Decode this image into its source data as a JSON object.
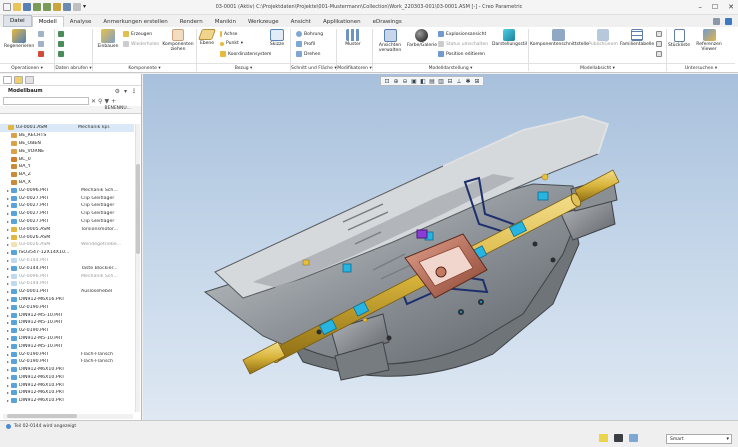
{
  "window": {
    "title": "03-0001 (Aktiv) C:\\Projektdaten\\Projekte\\001-Mustermann\\Collection\\Work_220303-001\\03-0001.ASM [-] - Creo Parametric"
  },
  "menu_tabs": [
    "Datei",
    "Modell",
    "Analyse",
    "Anmerkungen erstellen",
    "Rendern",
    "Manikin",
    "Werkzeuge",
    "Ansicht",
    "Applikationen",
    "eDrawings"
  ],
  "active_tab": "Modell",
  "ribbon": {
    "regenerieren": "Regenerieren",
    "einbauen": "Einbauen",
    "erzeugen": "Erzeugen",
    "wiederholen": "Wiederholen",
    "komponenten_ziehen": "Komponenten ziehen",
    "ebene": "Ebene",
    "achse": "Achse",
    "punkt": "Punkt",
    "koordinatensystem": "Koordinatensystem",
    "skizze": "Skizze",
    "bohrung": "Bohrung",
    "profil": "Profil",
    "drehen": "Drehen",
    "muster": "Muster",
    "ansichten_verwalten": "Ansichten verwalten",
    "farbe_galerie": "Farbe/Galerie",
    "explosionsansicht": "Explosionsansicht",
    "status_umschalten": "Status umschalten",
    "position_editieren": "Position editieren",
    "darstellungsstil": "Darstellungsstil",
    "komponentenschnittstelle": "Komponentenschnittstelle",
    "publish_geom": "PublishGeom",
    "familientabelle": "Familientabelle",
    "stueckliste": "Stückliste",
    "referenzen_viewer": "Referenzen Viewer",
    "groups": {
      "operationen": "Operationen ▾",
      "daten_abrufen": "Daten abrufen ▾",
      "komponente": "Komponente ▾",
      "bezug": "Bezug ▾",
      "schnitt_flaeche": "Schnitt und Fläche ▾",
      "modifikatoren": "Modifikatoren ▾",
      "modelldarstellung": "Modelldarstellung ▾",
      "modellabsicht": "Modellabsicht ▾",
      "untersuchen": "Untersuchen ▾"
    }
  },
  "model_tree": {
    "title": "Modellbaum",
    "search_placeholder": "",
    "column_name": "",
    "column_param": "BENENNU...",
    "rows": [
      {
        "name": "03-0001.ASM",
        "param": "Mechanik kpl.",
        "icon": "assembly",
        "exp": "",
        "state": "normal",
        "indent": 0
      },
      {
        "name": "BE_RECHTS",
        "param": "",
        "icon": "plane",
        "exp": "",
        "state": "normal",
        "indent": 1
      },
      {
        "name": "BE_OBEN",
        "param": "",
        "icon": "plane",
        "exp": "",
        "state": "normal",
        "indent": 1
      },
      {
        "name": "BE_VORNE",
        "param": "",
        "icon": "plane",
        "exp": "",
        "state": "normal",
        "indent": 1
      },
      {
        "name": "BC_0",
        "param": "",
        "icon": "csys",
        "exp": "",
        "state": "normal",
        "indent": 1
      },
      {
        "name": "BA_Y",
        "param": "",
        "icon": "axis",
        "exp": "",
        "state": "normal",
        "indent": 1
      },
      {
        "name": "BA_Z",
        "param": "",
        "icon": "axis",
        "exp": "",
        "state": "normal",
        "indent": 1
      },
      {
        "name": "BA_X",
        "param": "",
        "icon": "axis",
        "exp": "",
        "state": "normal",
        "indent": 1
      },
      {
        "name": "02-0096.PRT",
        "param": "Mechanik Sch...",
        "icon": "part",
        "exp": "▸",
        "state": "normal",
        "indent": 1
      },
      {
        "name": "02-0027.PRT",
        "param": "Clip Gleitlager",
        "icon": "part",
        "exp": "▸",
        "state": "normal",
        "indent": 1
      },
      {
        "name": "02-0027.PRT",
        "param": "Clip Gleitlager",
        "icon": "part",
        "exp": "▸",
        "state": "normal",
        "indent": 1
      },
      {
        "name": "02-0027.PRT",
        "param": "Clip Gleitlager",
        "icon": "part",
        "exp": "▸",
        "state": "normal",
        "indent": 1
      },
      {
        "name": "02-0027.PRT",
        "param": "Clip Gleitlager",
        "icon": "part",
        "exp": "▸",
        "state": "normal",
        "indent": 1
      },
      {
        "name": "03-0005.ASM",
        "param": "Torsionsmotor...",
        "icon": "assembly",
        "exp": "▸",
        "state": "normal",
        "indent": 1
      },
      {
        "name": "03-0026.ASM",
        "param": "",
        "icon": "assembly",
        "exp": "▸",
        "state": "normal",
        "indent": 1
      },
      {
        "name": "03-0026.ASM",
        "param": "Wendegetriebe...",
        "icon": "assembly",
        "exp": "▸",
        "state": "grey",
        "indent": 1
      },
      {
        "name": "ISO3547-12X14X10...",
        "param": "",
        "icon": "part",
        "exp": "▸",
        "state": "normal",
        "indent": 1
      },
      {
        "name": "02-0144.PRT",
        "param": "",
        "icon": "part",
        "exp": "▸",
        "state": "grey",
        "indent": 1
      },
      {
        "name": "02-0144.PRT",
        "param": "Taste Blockier...",
        "icon": "part",
        "exp": "▸",
        "state": "normal",
        "indent": 1
      },
      {
        "name": "02-0096.PRT",
        "param": "Mechanik Sch...",
        "icon": "part",
        "exp": "▸",
        "state": "grey",
        "indent": 1
      },
      {
        "name": "02-0144.PRT",
        "param": "",
        "icon": "part",
        "exp": "▸",
        "state": "grey",
        "indent": 1
      },
      {
        "name": "02-0001.PRT",
        "param": "Auslösehebel",
        "icon": "part",
        "exp": "▸",
        "state": "normal",
        "indent": 1
      },
      {
        "name": "DIN912-M6X16.PRT",
        "param": "",
        "icon": "part",
        "exp": "▸",
        "state": "normal",
        "indent": 1
      },
      {
        "name": "02-0190.PRT",
        "param": "",
        "icon": "part",
        "exp": "▸",
        "state": "normal",
        "indent": 1
      },
      {
        "name": "DIN912-M5-10.PRT",
        "param": "",
        "icon": "part",
        "exp": "▸",
        "state": "normal",
        "indent": 1
      },
      {
        "name": "DIN912-M5-10.PRT",
        "param": "",
        "icon": "part",
        "exp": "▸",
        "state": "normal",
        "indent": 1
      },
      {
        "name": "02-0190.PRT",
        "param": "",
        "icon": "part",
        "exp": "▸",
        "state": "normal",
        "indent": 1
      },
      {
        "name": "DIN912-M5-10.PRT",
        "param": "",
        "icon": "part",
        "exp": "▸",
        "state": "normal",
        "indent": 1
      },
      {
        "name": "DIN912-M5-10.PRT",
        "param": "",
        "icon": "part",
        "exp": "▸",
        "state": "normal",
        "indent": 1
      },
      {
        "name": "02-0190.PRT",
        "param": "Flach-Flansch",
        "icon": "part",
        "exp": "▸",
        "state": "normal",
        "indent": 1
      },
      {
        "name": "02-0190.PRT",
        "param": "Flach-Flansch",
        "icon": "part",
        "exp": "▸",
        "state": "normal",
        "indent": 1
      },
      {
        "name": "DIN912-M6X10.PRT",
        "param": "",
        "icon": "part",
        "exp": "▸",
        "state": "normal",
        "indent": 1
      },
      {
        "name": "DIN912-M6X10.PRT",
        "param": "",
        "icon": "part",
        "exp": "▸",
        "state": "normal",
        "indent": 1
      },
      {
        "name": "DIN912-M6X10.PRT",
        "param": "",
        "icon": "part",
        "exp": "▸",
        "state": "normal",
        "indent": 1
      },
      {
        "name": "DIN912-M6X10.PRT",
        "param": "",
        "icon": "part",
        "exp": "▸",
        "state": "normal",
        "indent": 1
      },
      {
        "name": "DIN912-M6X10.PRT",
        "param": "",
        "icon": "part",
        "exp": "▸",
        "state": "normal",
        "indent": 1
      }
    ]
  },
  "status": {
    "message": "Teil 02-0144 wird angezeigt",
    "filter": "Smart"
  },
  "colors": {
    "viewport_top": "#a8c0dc",
    "viewport_bottom": "#dfe8f3",
    "housing_grey": "#8e9499",
    "shaft_yellow": "#d7b33a",
    "bearing_cyan": "#27b4e0",
    "lever_copper": "#b56a54",
    "frame_blue": "#1e2f6d"
  }
}
